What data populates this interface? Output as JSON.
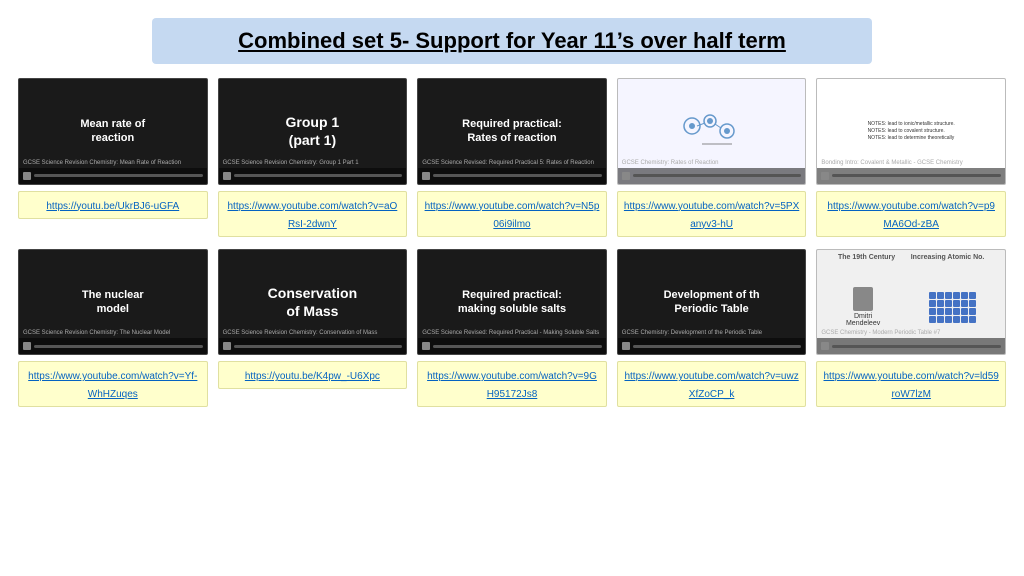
{
  "page": {
    "title": "Combined set 5- Support for Year 11’s over half term"
  },
  "cards": [
    {
      "id": "row1-col1",
      "thumb_type": "dark",
      "thumb_text": "Mean rate of\nreaction",
      "thumb_text_style": "normal",
      "label": "GCSE Science Revision Chemistry: Mean Rate of Reaction",
      "link_text": "https://youtu.be/UkrBJ6-uGFA",
      "link_url": "https://youtu.be/UkrBJ6-uGFA"
    },
    {
      "id": "row1-col2",
      "thumb_type": "dark",
      "thumb_text": "Group 1\n(part 1)",
      "thumb_text_style": "bold",
      "label": "GCSE Science Revision Chemistry: Group 1 Part 1",
      "link_text": "https://www.youtube.com/watch?v=aORsI-2dwnY",
      "link_url": "https://www.youtube.com/watch?v=aORsI-2dwnY"
    },
    {
      "id": "row1-col3",
      "thumb_type": "dark",
      "thumb_text": "Required practical:\nRates of reaction",
      "thumb_text_style": "normal",
      "label": "GCSE Science Revised: Required Practical 5: Rates of Reaction",
      "link_text": "https://www.youtube.com/watch?v=N5p06i9ilmo",
      "link_url": "https://www.youtube.com/watch?v=N5p06i9ilmo"
    },
    {
      "id": "row1-col4",
      "thumb_type": "molecules",
      "thumb_text": "",
      "label": "GCSE Chemistry: Rates of Reaction",
      "link_text": "https://www.youtube.com/watch?v=5PXanyv3-hU",
      "link_url": "https://www.youtube.com/watch?v=5PXanyv3-hU"
    },
    {
      "id": "row1-col5",
      "thumb_type": "notes",
      "thumb_text": "",
      "label": "Bonding Intro: Covalent & Metallic - GCSE Chemistry",
      "link_text": "https://www.youtube.com/watch?v=p9MA6Od-zBA",
      "link_url": "https://www.youtube.com/watch?v=p9MA6Od-zBA"
    },
    {
      "id": "row2-col1",
      "thumb_type": "dark",
      "thumb_text": "The nuclear\nmodel",
      "thumb_text_style": "normal",
      "label": "GCSE Science Revision Chemistry: The Nuclear Model",
      "link_text": "https://www.youtube.com/watch?v=Yf-WhHZuqes",
      "link_url": "https://www.youtube.com/watch?v=Yf-WhHZuqes"
    },
    {
      "id": "row2-col2",
      "thumb_type": "dark_bold",
      "thumb_text": "Conservation\nof Mass",
      "thumb_text_style": "bold",
      "label": "GCSE Science Revision Chemistry: Conservation of Mass",
      "link_text": "https://youtu.be/K4pw_-U6Xpc",
      "link_url": "https://youtu.be/K4pw_-U6Xpc"
    },
    {
      "id": "row2-col3",
      "thumb_type": "dark",
      "thumb_text": "Required practical:\nmaking soluble salts",
      "thumb_text_style": "normal",
      "label": "GCSE Science Revised: Required Practical - Making Soluble Salts",
      "link_text": "https://www.youtube.com/watch?v=9GH95172Js8",
      "link_url": "https://www.youtube.com/watch?v=9GH95172Js8"
    },
    {
      "id": "row2-col4",
      "thumb_type": "dark",
      "thumb_text": "Development of th\nPeriodic Table",
      "thumb_text_style": "normal",
      "label": "GCSE Chemistry: Development of the Periodic Table",
      "link_text": "https://www.youtube.com/watch?v=uwzXfZoCP_k",
      "link_url": "https://www.youtube.com/watch?v=uwzXfZoCP_k"
    },
    {
      "id": "row2-col5",
      "thumb_type": "periodic",
      "thumb_text": "",
      "label": "GCSE Chemistry - Modern Periodic Table #7",
      "link_text": "https://www.youtube.com/watch?v=ld59roW7lzM",
      "link_url": "https://www.youtube.com/watch?v=ld59roW7lzM"
    }
  ]
}
